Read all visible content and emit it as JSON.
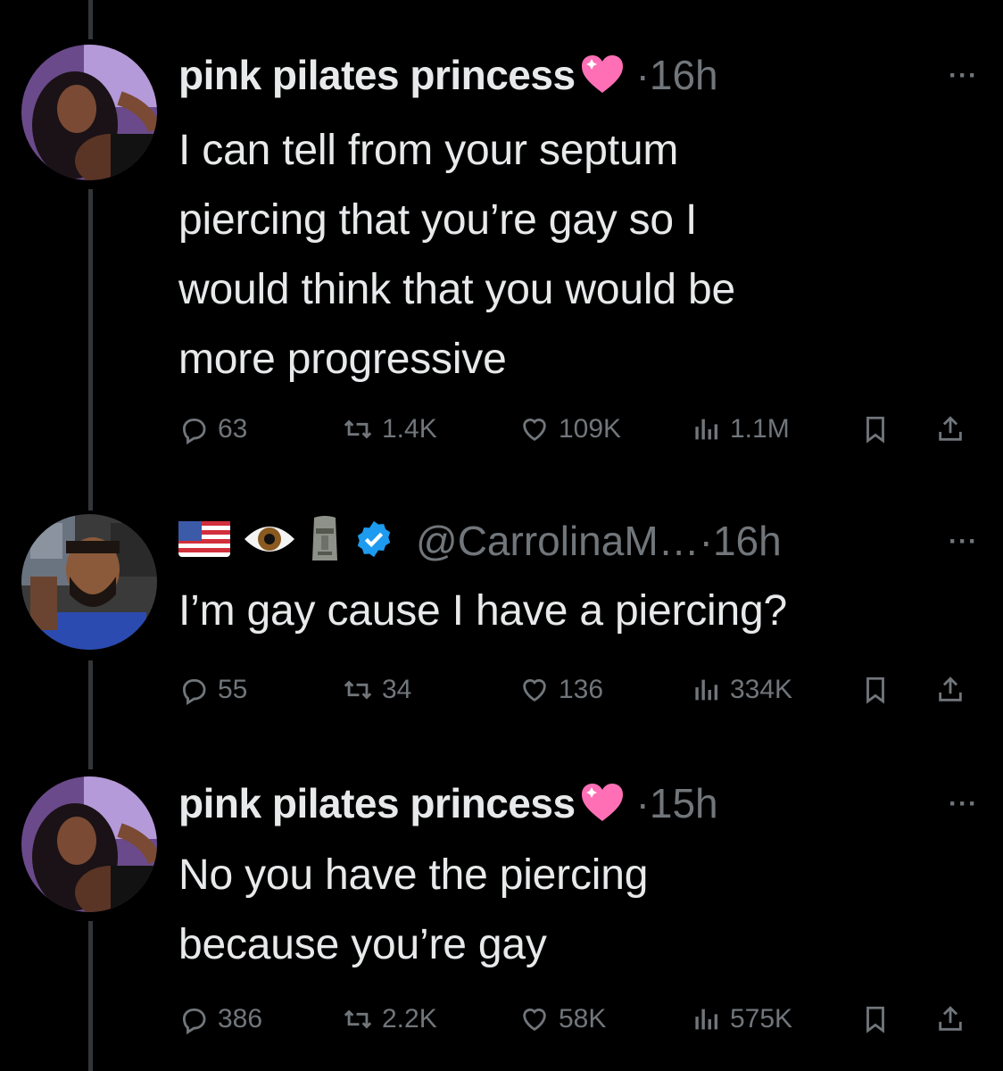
{
  "tweets": [
    {
      "name": "pink pilates princess",
      "time": "·16h",
      "text_lines": [
        "I can tell from your septum",
        "piercing that you’re gay so I",
        "would think that you would be",
        "more progressive"
      ],
      "stats": {
        "replies": "63",
        "reposts": "1.4K",
        "likes": "109K",
        "views": "1.1M"
      }
    },
    {
      "handle": "@CarrolinaM…",
      "time": "·16h",
      "header_emojis": [
        "us-flag-emoji",
        "eye-emoji",
        "moai-emoji"
      ],
      "verified": true,
      "text_lines": [
        "I’m gay cause I have a piercing?"
      ],
      "stats": {
        "replies": "55",
        "reposts": "34",
        "likes": "136",
        "views": "334K"
      }
    },
    {
      "name": "pink pilates princess",
      "time": "·15h",
      "text_lines": [
        "No you have the piercing",
        "because you’re gay"
      ],
      "stats": {
        "replies": "386",
        "reposts": "2.2K",
        "likes": "58K",
        "views": "575K"
      }
    }
  ],
  "more_label": "···",
  "colors": {
    "background": "#000000",
    "text": "#e7e9ea",
    "muted": "#71767b",
    "verified": "#1d9bf0",
    "heart_emoji": "#ff6fb5"
  }
}
